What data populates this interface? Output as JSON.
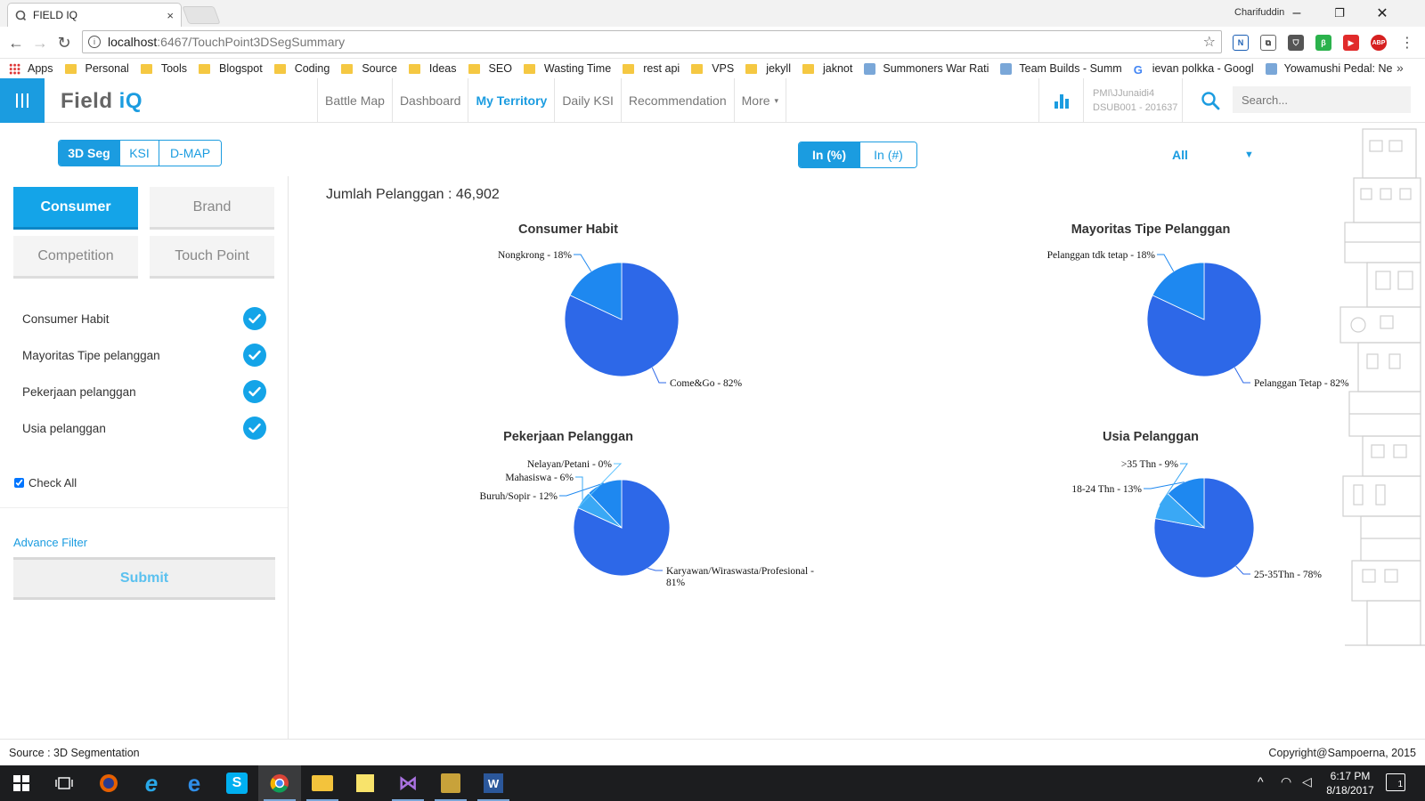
{
  "browser": {
    "tab_title": "FIELD IQ",
    "tab_close": "×",
    "window_user": "Charifuddin",
    "window_controls": {
      "minimize": "–",
      "restore": "❐",
      "close": "✕"
    },
    "url_host": "localhost",
    "url_path": ":6467/TouchPoint3DSegSummary",
    "star": "☆",
    "menu": "⋮"
  },
  "bookmarks": [
    {
      "label": "Apps",
      "icon": "apps-icon"
    },
    {
      "label": "Personal",
      "icon": "folder-icon"
    },
    {
      "label": "Tools",
      "icon": "folder-icon"
    },
    {
      "label": "Blogspot",
      "icon": "folder-icon"
    },
    {
      "label": "Coding",
      "icon": "folder-icon"
    },
    {
      "label": "Source",
      "icon": "folder-icon"
    },
    {
      "label": "Ideas",
      "icon": "folder-icon"
    },
    {
      "label": "SEO",
      "icon": "folder-icon"
    },
    {
      "label": "Wasting Time",
      "icon": "folder-icon"
    },
    {
      "label": "rest api",
      "icon": "folder-icon"
    },
    {
      "label": "VPS",
      "icon": "folder-icon"
    },
    {
      "label": "jekyll",
      "icon": "folder-icon"
    },
    {
      "label": "jaknot",
      "icon": "folder-icon"
    },
    {
      "label": "Summoners War Rati",
      "icon": "site-icon"
    },
    {
      "label": "Team Builds - Summ",
      "icon": "site-icon"
    },
    {
      "label": "ievan polkka - Googl",
      "icon": "google-icon"
    },
    {
      "label": "Yowamushi Pedal: Ne",
      "icon": "site-icon"
    }
  ],
  "bookmarks_more": "»",
  "app": {
    "logo_main": "Field ",
    "logo_accent": "iQ",
    "nav": [
      {
        "label": "Battle Map",
        "active": false
      },
      {
        "label": "Dashboard",
        "active": false
      },
      {
        "label": "My Territory",
        "active": true
      },
      {
        "label": "Daily KSI",
        "active": false
      },
      {
        "label": "Recommendation",
        "active": false
      },
      {
        "label": "More",
        "active": false
      }
    ],
    "nav_more_caret": "▾",
    "user_line1": "PMI\\JJunaidi4",
    "user_line2": "DSUB001 - 201637",
    "search_placeholder": "Search..."
  },
  "subheader": {
    "view_tabs": [
      {
        "label": "3D Seg",
        "active": true
      },
      {
        "label": "KSI",
        "active": false
      },
      {
        "label": "D-MAP",
        "active": false
      }
    ],
    "unit_tabs": [
      {
        "label": "In (%)",
        "active": true
      },
      {
        "label": "In (#)",
        "active": false
      }
    ],
    "filter_value": "All",
    "filter_caret": "▼"
  },
  "sidebar": {
    "category_buttons": [
      {
        "label": "Consumer",
        "active": true
      },
      {
        "label": "Brand",
        "active": false
      },
      {
        "label": "Competition",
        "active": false
      },
      {
        "label": "Touch Point",
        "active": false
      }
    ],
    "layers": [
      {
        "label": "Consumer Habit",
        "checked": true
      },
      {
        "label": "Mayoritas Tipe pelanggan",
        "checked": true
      },
      {
        "label": "Pekerjaan pelanggan",
        "checked": true
      },
      {
        "label": "Usia pelanggan",
        "checked": true
      }
    ],
    "check_all_label": "Check All",
    "advance_filter": "Advance Filter",
    "submit_label": "Submit"
  },
  "main": {
    "total_label": "Jumlah Pelanggan : 46,902"
  },
  "colors": {
    "accent": "#1b9ce0",
    "slice_main": "#2d68e8",
    "slice_2": "#1e88f0",
    "slice_3": "#3aa8f5",
    "slice_4": "#5fc4ff"
  },
  "chart_data": [
    {
      "type": "pie",
      "title": "Consumer Habit",
      "slices": [
        {
          "label": "Come&Go - 82%",
          "value": 82
        },
        {
          "label": "Nongkrong - 18%",
          "value": 18
        }
      ]
    },
    {
      "type": "pie",
      "title": "Mayoritas Tipe Pelanggan",
      "slices": [
        {
          "label": "Pelanggan Tetap - 82%",
          "value": 82
        },
        {
          "label": "Pelanggan tdk tetap - 18%",
          "value": 18
        }
      ]
    },
    {
      "type": "pie",
      "title": "Pekerjaan Pelanggan",
      "slices": [
        {
          "label": "Karyawan/Wiraswasta/Profesional - 81%",
          "value": 81
        },
        {
          "label": "Buruh/Sopir - 12%",
          "value": 12
        },
        {
          "label": "Mahasiswa - 6%",
          "value": 6
        },
        {
          "label": "Nelayan/Petani - 0%",
          "value": 0
        }
      ]
    },
    {
      "type": "pie",
      "title": "Usia Pelanggan",
      "slices": [
        {
          "label": "25-35Thn - 78%",
          "value": 78
        },
        {
          "label": "18-24 Thn - 13%",
          "value": 13
        },
        {
          "label": ">35 Thn - 9%",
          "value": 9
        }
      ]
    }
  ],
  "footer": {
    "source": "Source : 3D Segmentation",
    "copyright": "Copyright@Sampoerna, 2015"
  },
  "taskbar": {
    "time": "6:17 PM",
    "date": "8/18/2017",
    "notification_count": "1"
  }
}
